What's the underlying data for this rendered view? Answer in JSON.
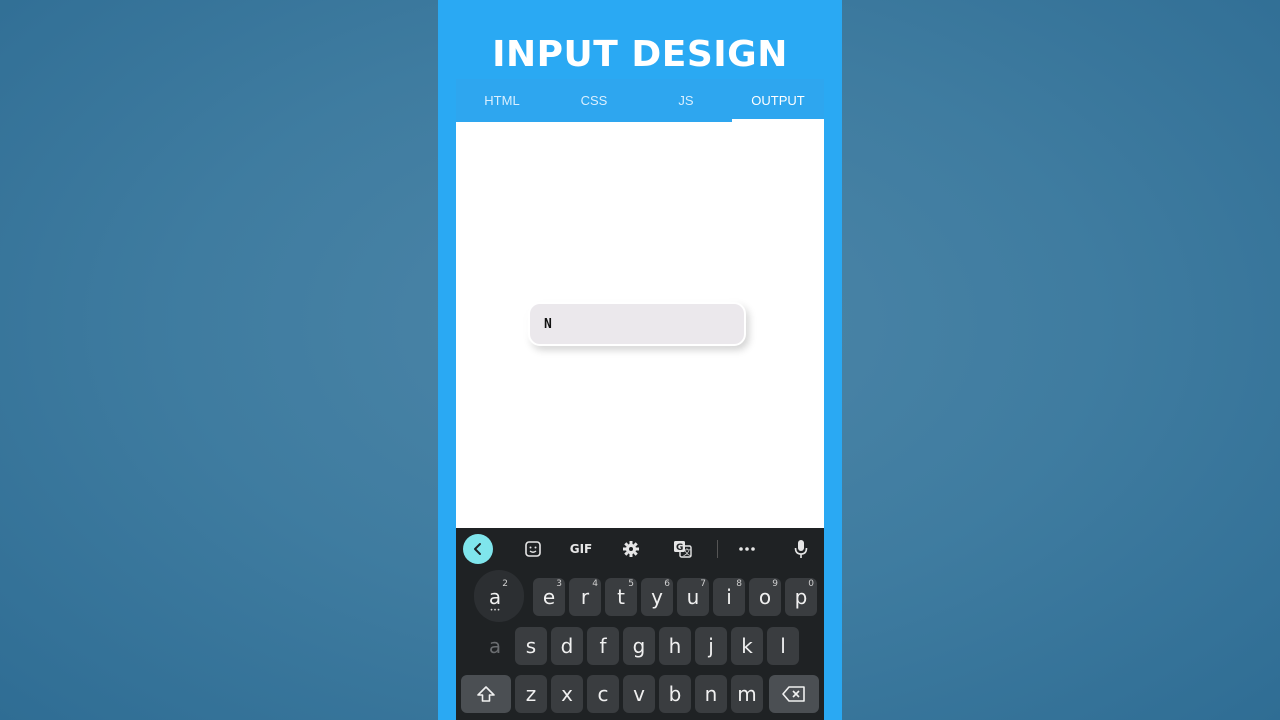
{
  "title": "INPUT DESIGN",
  "tabs": [
    {
      "label": "HTML",
      "active": false
    },
    {
      "label": "CSS",
      "active": false
    },
    {
      "label": "JS",
      "active": false
    },
    {
      "label": "OUTPUT",
      "active": true
    }
  ],
  "input": {
    "value": "N"
  },
  "keyboard": {
    "toolbar": {
      "back_icon": "chevron-left-icon",
      "sticker_icon": "sticker-icon",
      "gif_label": "GIF",
      "settings_icon": "gear-icon",
      "translate_icon": "translate-icon",
      "more_icon": "more-icon",
      "mic_icon": "mic-icon"
    },
    "row1": [
      {
        "char": "a",
        "sup": "2"
      },
      {
        "char": "e",
        "sup": "3"
      },
      {
        "char": "r",
        "sup": "4"
      },
      {
        "char": "t",
        "sup": "5"
      },
      {
        "char": "y",
        "sup": "6"
      },
      {
        "char": "u",
        "sup": "7"
      },
      {
        "char": "i",
        "sup": "8"
      },
      {
        "char": "o",
        "sup": "9"
      },
      {
        "char": "p",
        "sup": "0"
      }
    ],
    "row2": [
      "a",
      "s",
      "d",
      "f",
      "g",
      "h",
      "j",
      "k",
      "l"
    ],
    "row3": [
      "z",
      "x",
      "c",
      "v",
      "b",
      "n",
      "m"
    ],
    "shift_icon": "shift-icon",
    "backspace_icon": "backspace-icon"
  },
  "colors": {
    "phone_bg": "#2aa9f3",
    "keyboard_bg": "#1f2224",
    "key_bg": "#3a3d40",
    "accent": "#7fe5ec"
  }
}
